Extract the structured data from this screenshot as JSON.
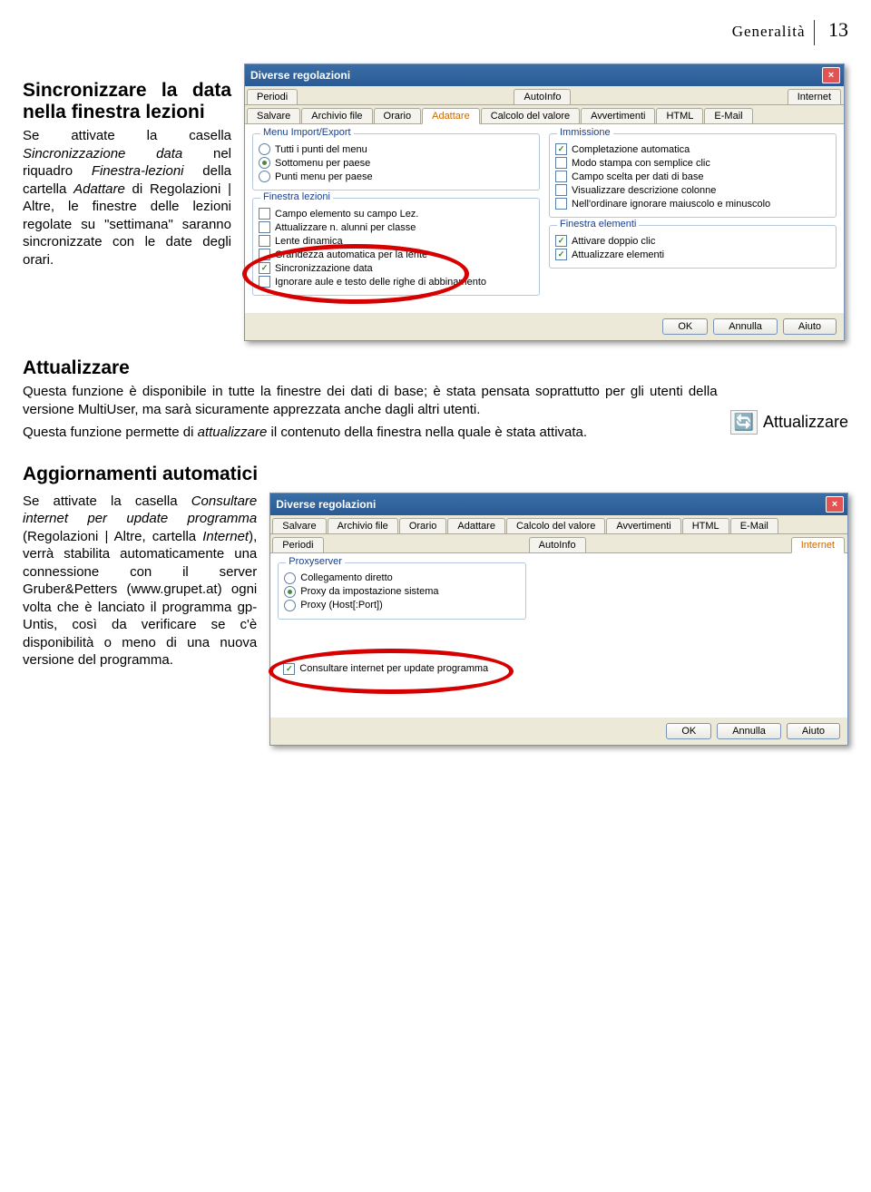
{
  "header": {
    "title": "Generalità",
    "page": "13"
  },
  "s1": {
    "heading": "Sincronizzare la data nella finestra lezioni",
    "para": "Se attivate la casella Sincronizzazione data nel riquadro Finestra-lezioni della cartella Adattare di Regolazioni | Altre, le finestre delle lezioni regolate su \"settimana\" saranno sincronizzate con le date degli orari."
  },
  "dialog1": {
    "title": "Diverse regolazioni",
    "tabsRow1": [
      "Periodi",
      "AutoInfo",
      "Internet"
    ],
    "tabsRow2": [
      "Salvare",
      "Archivio file",
      "Orario",
      "Adattare",
      "Calcolo del valore",
      "Avvertimenti",
      "HTML",
      "E-Mail"
    ],
    "activeTab": "Adattare",
    "groupMenu": {
      "legend": "Menu Import/Export",
      "opts": [
        {
          "label": "Tutti i punti del menu",
          "sel": false
        },
        {
          "label": "Sottomenu per paese",
          "sel": true
        },
        {
          "label": "Punti menu per paese",
          "sel": false
        }
      ]
    },
    "groupLez": {
      "legend": "Finestra lezioni",
      "opts": [
        {
          "label": "Campo elemento su campo Lez.",
          "chk": false
        },
        {
          "label": "Attualizzare n. alunni per classe",
          "chk": false
        },
        {
          "label": "Lente dinamica",
          "chk": false
        },
        {
          "label": "Grandezza automatica per la lente",
          "chk": false
        },
        {
          "label": "Sincronizzazione data",
          "chk": true
        },
        {
          "label": "Ignorare aule e testo delle righe di abbinamento",
          "chk": false
        }
      ]
    },
    "groupImm": {
      "legend": "Immissione",
      "opts": [
        {
          "label": "Completazione automatica",
          "chk": true
        },
        {
          "label": "Modo stampa con semplice clic",
          "chk": false
        },
        {
          "label": "Campo scelta per dati di base",
          "chk": false
        },
        {
          "label": "Visualizzare descrizione colonne",
          "chk": false
        },
        {
          "label": "Nell'ordinare ignorare maiuscolo e minuscolo",
          "chk": false
        }
      ]
    },
    "groupElem": {
      "legend": "Finestra elementi",
      "opts": [
        {
          "label": "Attivare doppio clic",
          "chk": true
        },
        {
          "label": "Attualizzare elementi",
          "chk": true
        }
      ]
    },
    "buttons": {
      "ok": "OK",
      "cancel": "Annulla",
      "help": "Aiuto"
    }
  },
  "s2": {
    "heading": "Attualizzare",
    "para1": "Questa funzione è disponibile in tutte la finestre dei dati di base; è stata pensata soprattutto per gli utenti della versione MultiUser, ma sarà sicuramente apprezzata anche dagli altri utenti.",
    "para2": "Questa funzione permette di attualizzare il contenuto della finestra nella quale è stata attivata.",
    "iconLabel": "Attualizzare"
  },
  "s3": {
    "heading": "Aggiornamenti automatici",
    "para": "Se attivate la casella Consultare internet per update programma (Regolazioni | Altre, cartella Internet), verrà stabilita automaticamente una connessione con il server Gruber&Petters (www.grupet.at) ogni volta che è lanciato il programma gp-Untis, così da verificare se c'è disponibilità o meno di una nuova versione del programma."
  },
  "dialog2": {
    "title": "Diverse regolazioni",
    "tabsRow1": [
      "Salvare",
      "Archivio file",
      "Orario",
      "Adattare",
      "Calcolo del valore",
      "Avvertimenti",
      "HTML",
      "E-Mail"
    ],
    "tabsRow2": [
      "Periodi",
      "AutoInfo",
      "Internet"
    ],
    "activeTab": "Internet",
    "groupProxy": {
      "legend": "Proxyserver",
      "opts": [
        {
          "label": "Collegamento diretto",
          "sel": false
        },
        {
          "label": "Proxy da impostazione sistema",
          "sel": true
        },
        {
          "label": "Proxy (Host[:Port])",
          "sel": false
        }
      ]
    },
    "chkUpdate": {
      "label": "Consultare internet per update programma",
      "chk": true
    },
    "buttons": {
      "ok": "OK",
      "cancel": "Annulla",
      "help": "Aiuto"
    }
  }
}
